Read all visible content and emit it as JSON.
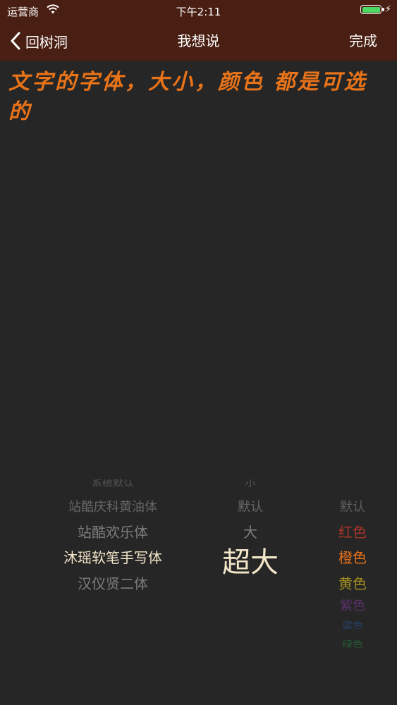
{
  "status_bar": {
    "carrier": "运营商",
    "time": "下午2:11",
    "battery_percent": 100
  },
  "nav": {
    "back_label": "回树洞",
    "title": "我想说",
    "done_label": "完成"
  },
  "editor": {
    "text": "文字的字体，大小，颜色 都是可选的",
    "text_color": "#e97318"
  },
  "pickers": {
    "fonts": [
      "系统默认",
      "站酷庆科黄油体",
      "站酷欢乐体",
      "沐瑶软笔手写体",
      "汉仪贤二体"
    ],
    "font_selected": "沐瑶软笔手写体",
    "sizes": [
      "小",
      "默认",
      "大",
      "超大"
    ],
    "size_selected": "超大",
    "colors": [
      {
        "label": "默认",
        "hex": "#8a8a8a"
      },
      {
        "label": "红色",
        "hex": "#d83a2a"
      },
      {
        "label": "橙色",
        "hex": "#e97318"
      },
      {
        "label": "黄色",
        "hex": "#cdb21f"
      },
      {
        "label": "紫色",
        "hex": "#8a3aa8"
      },
      {
        "label": "蓝色",
        "hex": "#2a68c8"
      },
      {
        "label": "绿色",
        "hex": "#2aa84a"
      }
    ],
    "color_selected": "橙色"
  },
  "colors": {
    "nav_bg": "#4a1f13",
    "page_bg": "#262626"
  }
}
